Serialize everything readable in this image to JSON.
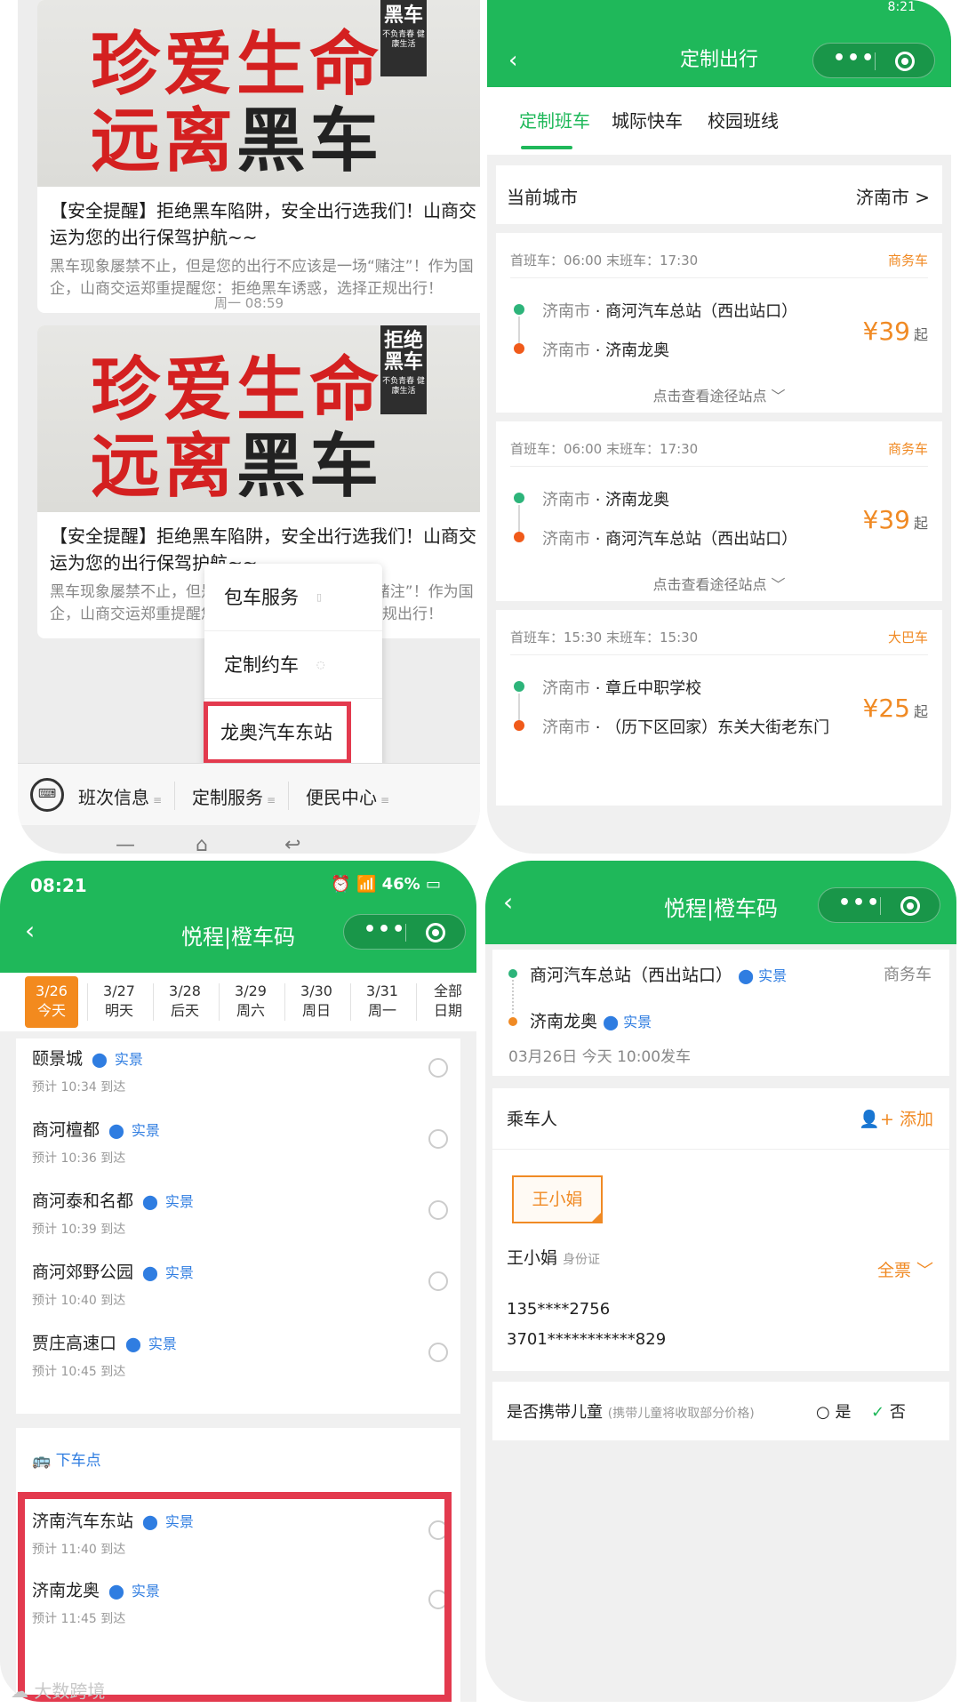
{
  "panel1": {
    "articles": [
      {
        "poster_line1": "珍爱生命",
        "poster_line2_a": "远离",
        "poster_line2_b": "黑车",
        "stamp_main": "黑车",
        "stamp_sub": "不负青春 健康生活",
        "title": "【安全提醒】拒绝黑车陷阱，安全出行选我们！山商交运为您的出行保驾护航~~",
        "desc": "黑车现象屡禁不止，但是您的出行不应该是一场“赌注”！作为国企，山商交运郑重提醒您：拒绝黑车诱惑，选择正规出行！"
      },
      {
        "poster_line1": "珍爱生命",
        "poster_line2_a": "远离",
        "poster_line2_b": "黑车",
        "stamp_main": "拒绝黑车",
        "stamp_sub": "不负青春 健康生活",
        "title": "【安全提醒】拒绝黑车陷阱，安全出行选我们！山商交运为您的出行保驾护航~~",
        "desc": "黑车现象屡禁不止，但是您的出行不应该是一场“赌注”！作为国企，山商交运郑重提醒您：拒绝黑车诱惑，选择正规出行！"
      }
    ],
    "timestamp": "周一 08:59",
    "popup": [
      "包车服务",
      "定制约车",
      "龙奥汽车东站"
    ],
    "menu": [
      "班次信息",
      "定制服务",
      "便民中心"
    ]
  },
  "panel2": {
    "status": "8:21",
    "title": "定制出行",
    "tabs": [
      "定制班车",
      "城际快车",
      "校园班线"
    ],
    "city_label": "当前城市",
    "city_value": "济南市 >",
    "via_text": "点击查看途径站点",
    "routes": [
      {
        "times": "首班车：06:00 末班车：17:30",
        "type": "商务车",
        "from_city": "济南市",
        "from": "商河汽车总站（西出站口）",
        "to_city": "济南市",
        "to": "济南龙奥",
        "price": "¥39",
        "unit": "起"
      },
      {
        "times": "首班车：06:00 末班车：17:30",
        "type": "商务车",
        "from_city": "济南市",
        "from": "济南龙奥",
        "to_city": "济南市",
        "to": "商河汽车总站（西出站口）",
        "price": "¥39",
        "unit": "起"
      },
      {
        "times": "首班车：15:30 末班车：15:30",
        "type": "大巴车",
        "from_city": "济南市",
        "from": "章丘中职学校",
        "to_city": "济南市",
        "to": "（历下区回家）东关大街老东门",
        "price": "¥25",
        "unit": "起"
      }
    ],
    "colors": {
      "green": "#1fb85a",
      "orange": "#f08a24",
      "start_dot": "#2db47a",
      "end_dot": "#f05a1a"
    }
  },
  "panel3": {
    "time": "08:21",
    "status": "46%",
    "title": "悦程|橙车码",
    "dates": [
      {
        "d": "3/26",
        "w": "今天"
      },
      {
        "d": "3/27",
        "w": "明天"
      },
      {
        "d": "3/28",
        "w": "后天"
      },
      {
        "d": "3/29",
        "w": "周六"
      },
      {
        "d": "3/30",
        "w": "周日"
      },
      {
        "d": "3/31",
        "w": "周一"
      },
      {
        "d": "全部",
        "w": "日期"
      }
    ],
    "tag": "实景",
    "stops": [
      {
        "name": "颐景城",
        "eta": "预计 10:34 到达"
      },
      {
        "name": "商河檀都",
        "eta": "预计 10:36 到达"
      },
      {
        "name": "商河泰和名都",
        "eta": "预计 10:39 到达"
      },
      {
        "name": "商河郊野公园",
        "eta": "预计 10:40 到达"
      },
      {
        "name": "贾庄高速口",
        "eta": "预计 10:45 到达"
      }
    ],
    "drop_header": "下车点",
    "drop_stops": [
      {
        "name": "济南汽车东站",
        "eta": "预计 11:40 到达"
      },
      {
        "name": "济南龙奥",
        "eta": "预计 11:45 到达"
      }
    ]
  },
  "panel4": {
    "title": "悦程|橙车码",
    "from": "商河汽车总站（西出站口）",
    "to": "济南龙奥",
    "tag": "实景",
    "vehicle": "商务车",
    "depart": "03月26日 今天 10:00发车",
    "passenger_label": "乘车人",
    "add_label": "添加",
    "chip": "王小娟",
    "name": "王小娟",
    "id_type": "身份证",
    "phone": "135****2756",
    "id_no": "3701***********829",
    "ticket": "全票",
    "child_label": "是否携带儿童",
    "child_note": "(携带儿童将收取部分价格)",
    "yes": "是",
    "no": "否"
  },
  "watermark": "大数跨境"
}
